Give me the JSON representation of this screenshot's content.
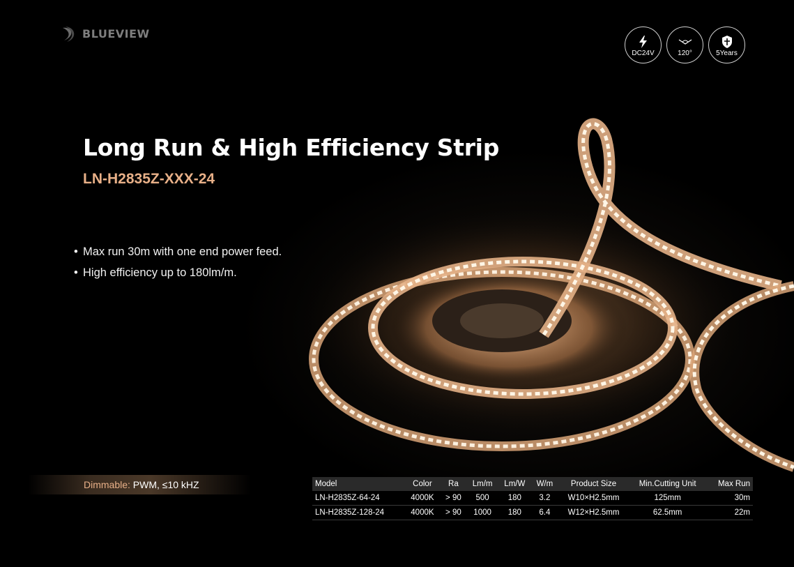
{
  "brand": {
    "logo_text": "BLUEVIEW"
  },
  "badges": [
    {
      "icon": "lightning-icon",
      "label": "DC24V"
    },
    {
      "icon": "beam-angle-icon",
      "label": "120°"
    },
    {
      "icon": "shield-icon",
      "label": "5Years"
    }
  ],
  "title": "Long Run & High Efficiency Strip",
  "model_code": "LN-H2835Z-XXX-24",
  "features": [
    "Max run 30m with one end power feed.",
    "High efficiency up to 180lm/m."
  ],
  "dimmable": {
    "key": "Dimmable:",
    "value": "PWM, ≤10 kHZ"
  },
  "colors": {
    "accent": "#e8b088",
    "background": "#000000",
    "led_glow": "#fff3dc"
  },
  "spec_table": {
    "headers": [
      "Model",
      "Color",
      "Ra",
      "Lm/m",
      "Lm/W",
      "W/m",
      "Product Size",
      "Min.Cutting Unit",
      "Max Run"
    ],
    "rows": [
      [
        "LN-H2835Z-64-24",
        "4000K",
        "> 90",
        "500",
        "180",
        "3.2",
        "W10×H2.5mm",
        "125mm",
        "30m"
      ],
      [
        "LN-H2835Z-128-24",
        "4000K",
        "> 90",
        "1000",
        "180",
        "6.4",
        "W12×H2.5mm",
        "62.5mm",
        "22m"
      ]
    ]
  }
}
